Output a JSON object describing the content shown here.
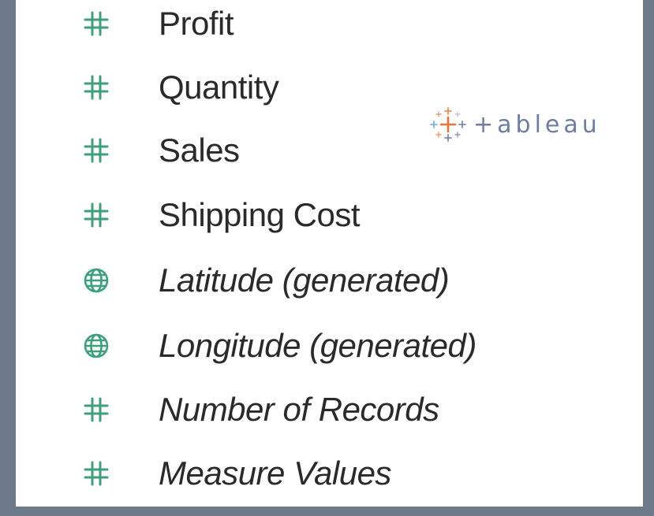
{
  "fields": [
    {
      "label": "Profit",
      "icon": "number-icon",
      "generated": false
    },
    {
      "label": "Quantity",
      "icon": "number-icon",
      "generated": false
    },
    {
      "label": "Sales",
      "icon": "number-icon",
      "generated": false
    },
    {
      "label": "Shipping Cost",
      "icon": "number-icon",
      "generated": false
    },
    {
      "label": "Latitude (generated)",
      "icon": "globe-icon",
      "generated": true
    },
    {
      "label": "Longitude (generated)",
      "icon": "globe-icon",
      "generated": true
    },
    {
      "label": "Number of Records",
      "icon": "number-icon",
      "generated": true
    },
    {
      "label": "Measure Values",
      "icon": "number-icon",
      "generated": true
    }
  ],
  "watermark": {
    "text": "+ableau"
  },
  "colors": {
    "measure_green": "#3ea07a",
    "frame": "#6c7a8a"
  }
}
